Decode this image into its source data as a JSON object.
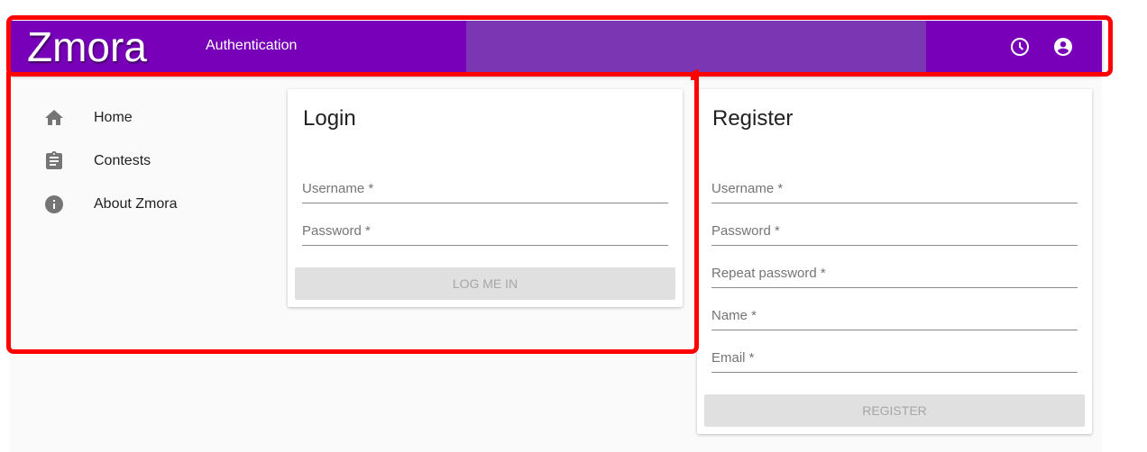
{
  "header": {
    "logo": "Zmora",
    "section": "Authentication",
    "icons": [
      "clock-icon",
      "account-circle-icon"
    ],
    "color": "#7800b8",
    "mid_color": "#7a36b3"
  },
  "sidebar": {
    "items": [
      {
        "label": "Home",
        "icon": "home-icon"
      },
      {
        "label": "Contests",
        "icon": "clipboard-icon"
      },
      {
        "label": "About Zmora",
        "icon": "info-icon"
      }
    ]
  },
  "login": {
    "title": "Login",
    "fields": [
      "Username *",
      "Password *"
    ],
    "button": "LOG ME IN"
  },
  "register": {
    "title": "Register",
    "fields": [
      "Username *",
      "Password *",
      "Repeat password *",
      "Name *",
      "Email *"
    ],
    "button": "REGISTER"
  }
}
